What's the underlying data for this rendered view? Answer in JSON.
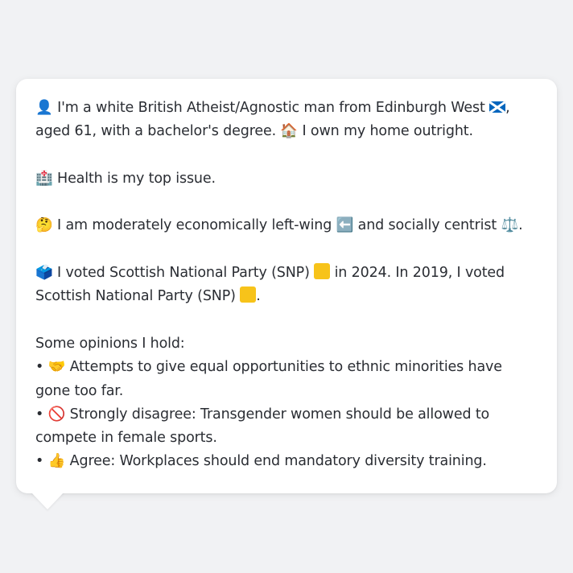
{
  "message": {
    "intro_a": "I'm a white British Atheist/Agnostic man from Edinburgh West ",
    "intro_b": ", aged 61, with a bachelor's degree. ",
    "intro_c": " I own my home outright.",
    "health": " Health is my top issue.",
    "econ_a": " I am moderately economically left-wing ",
    "econ_b": " and socially centrist ",
    "econ_c": ".",
    "vote_a": " I voted Scottish National Party (SNP) ",
    "vote_b": " in 2024. In 2019, I voted Scottish National Party (SNP) ",
    "vote_c": ".",
    "opinions_heading": "Some opinions I hold:",
    "opinions": [
      {
        "text": " Attempts to give equal opportunities to ethnic minorities have gone too far."
      },
      {
        "text": " Strongly disagree: Transgender women should be allowed to compete in female sports."
      },
      {
        "text": " Agree: Workplaces should end mandatory diversity training."
      }
    ]
  },
  "icons": {
    "person": "👤",
    "house": "🏠",
    "hospital": "🏥",
    "thinking": "🤔",
    "left_arrow": "⬅️",
    "scales": "⚖️",
    "ballot": "🗳️",
    "handshake": "🤝",
    "no_entry": "🚫",
    "thumbs_up": "👍",
    "bullet": "•"
  },
  "colors": {
    "background": "#f1f2f4",
    "bubble": "#ffffff",
    "text": "#2a2d33",
    "snp_yellow": "#f7c31a",
    "scotland_blue": "#0065bd"
  }
}
